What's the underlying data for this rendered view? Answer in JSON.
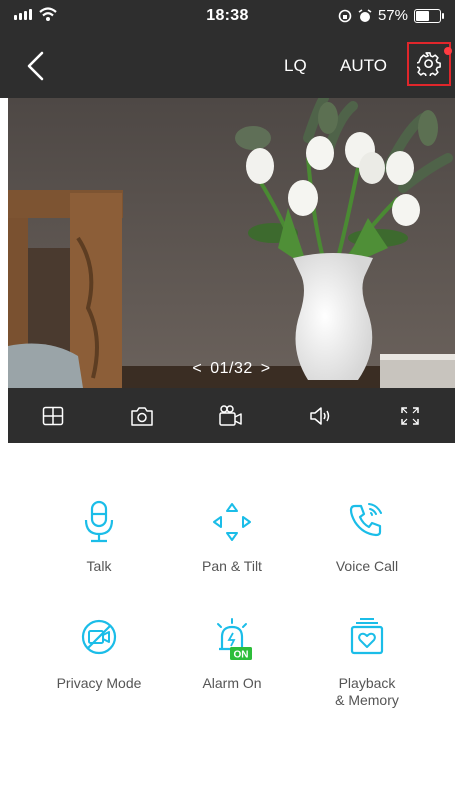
{
  "status_bar": {
    "time": "18:38",
    "battery": "57%",
    "battery_level": 0.57
  },
  "nav": {
    "quality_label": "LQ",
    "mode_label": "AUTO"
  },
  "camera": {
    "counter_prev": "<",
    "counter": "01/32",
    "counter_next": ">"
  },
  "actions": [
    {
      "label": "Talk",
      "icon": "microphone-icon"
    },
    {
      "label": "Pan & Tilt",
      "icon": "pan-tilt-icon"
    },
    {
      "label": "Voice Call",
      "icon": "phone-call-icon"
    },
    {
      "label": "Privacy Mode",
      "icon": "privacy-camera-icon"
    },
    {
      "label": "Alarm On",
      "icon": "alarm-icon",
      "badge": "ON"
    },
    {
      "label": "Playback\n& Memory",
      "icon": "playback-icon"
    }
  ],
  "colors": {
    "accent": "#1bbde8",
    "header": "#2e2e2e",
    "highlight": "#e0262b",
    "badge_green": "#2dbd3a"
  }
}
